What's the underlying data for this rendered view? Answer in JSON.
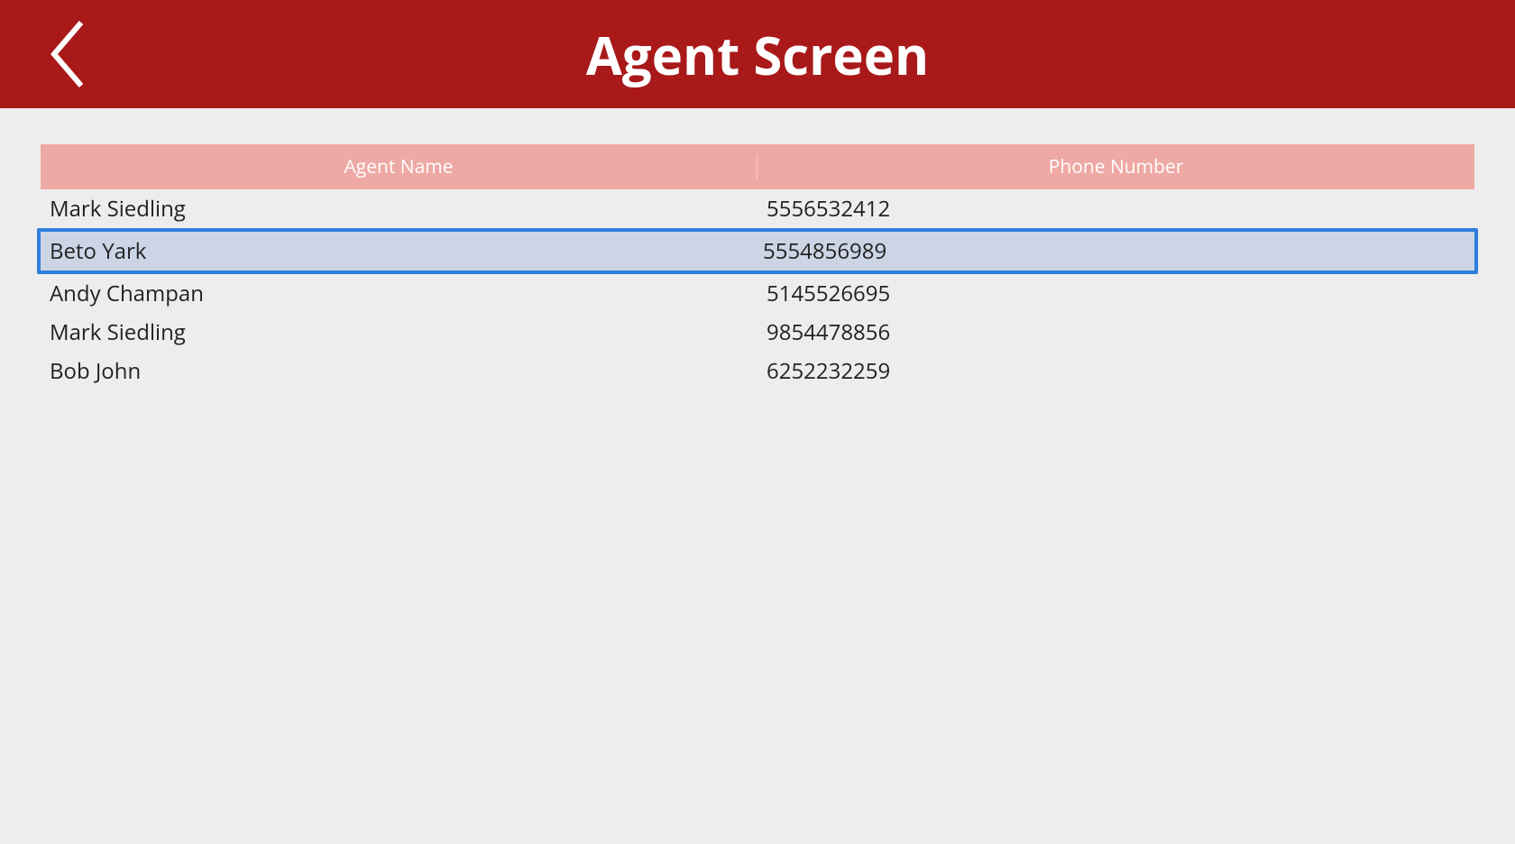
{
  "header": {
    "title": "Agent Screen"
  },
  "table": {
    "headers": {
      "name": "Agent Name",
      "phone": "Phone Number"
    },
    "selected_index": 1,
    "rows": [
      {
        "name": "Mark Siedling",
        "phone": "5556532412"
      },
      {
        "name": "Beto Yark",
        "phone": "5554856989"
      },
      {
        "name": "Andy Champan",
        "phone": "5145526695"
      },
      {
        "name": "Mark Siedling",
        "phone": "9854478856"
      },
      {
        "name": "Bob John",
        "phone": "6252232259"
      }
    ]
  }
}
